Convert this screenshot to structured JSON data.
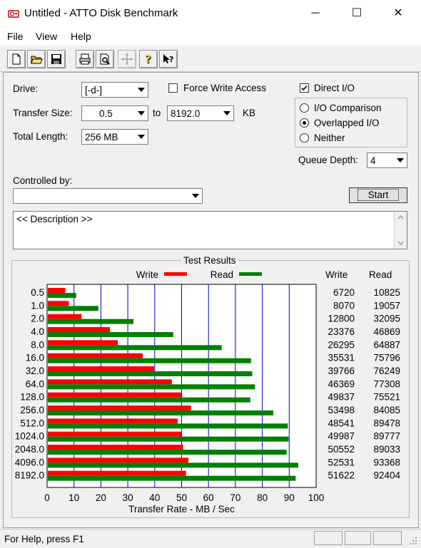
{
  "window": {
    "title": "Untitled - ATTO Disk Benchmark",
    "minimize": "─",
    "maximize": "☐",
    "close": "✕"
  },
  "menu": [
    "File",
    "View",
    "Help"
  ],
  "toolbar_icons": [
    "new-icon",
    "open-icon",
    "save-icon",
    "print-icon",
    "print-preview-icon",
    "move-icon",
    "help-icon",
    "context-help-icon"
  ],
  "form": {
    "drive_label": "Drive:",
    "drive_value": "[-d-]",
    "force_write_label": "Force Write Access",
    "force_write_checked": false,
    "direct_io_label": "Direct I/O",
    "direct_io_checked": true,
    "transfer_size_label": "Transfer Size:",
    "transfer_from": "0.5",
    "to_label": "to",
    "transfer_to": "8192.0",
    "kb_label": "KB",
    "total_length_label": "Total Length:",
    "total_length_value": "256 MB",
    "io_options": [
      "I/O Comparison",
      "Overlapped I/O",
      "Neither"
    ],
    "io_selected": "Overlapped I/O",
    "queue_depth_label": "Queue Depth:",
    "queue_depth_value": "4",
    "controlled_by_label": "Controlled by:",
    "controlled_by_value": "",
    "start_label": "Start",
    "description": "<< Description >>"
  },
  "results": {
    "group_title": "Test Results",
    "write_header": "Write",
    "read_header": "Read",
    "rows": [
      {
        "size": "0.5",
        "write": "6720",
        "read": "10825"
      },
      {
        "size": "1.0",
        "write": "8070",
        "read": "19057"
      },
      {
        "size": "2.0",
        "write": "12800",
        "read": "32095"
      },
      {
        "size": "4.0",
        "write": "23376",
        "read": "46869"
      },
      {
        "size": "8.0",
        "write": "26295",
        "read": "64887"
      },
      {
        "size": "16.0",
        "write": "35531",
        "read": "75796"
      },
      {
        "size": "32.0",
        "write": "39766",
        "read": "76249"
      },
      {
        "size": "64.0",
        "write": "46369",
        "read": "77308"
      },
      {
        "size": "128.0",
        "write": "49837",
        "read": "75521"
      },
      {
        "size": "256.0",
        "write": "53498",
        "read": "84085"
      },
      {
        "size": "512.0",
        "write": "48541",
        "read": "89478"
      },
      {
        "size": "1024.0",
        "write": "49987",
        "read": "89777"
      },
      {
        "size": "2048.0",
        "write": "50552",
        "read": "89033"
      },
      {
        "size": "4096.0",
        "write": "52531",
        "read": "93368"
      },
      {
        "size": "8192.0",
        "write": "51622",
        "read": "92404"
      }
    ]
  },
  "chart_data": {
    "type": "bar",
    "orientation": "horizontal",
    "categories": [
      "0.5",
      "1.0",
      "2.0",
      "4.0",
      "8.0",
      "16.0",
      "32.0",
      "64.0",
      "128.0",
      "256.0",
      "512.0",
      "1024.0",
      "2048.0",
      "4096.0",
      "8192.0"
    ],
    "series": [
      {
        "name": "Write",
        "color": "#ff0000",
        "values": [
          6.72,
          8.07,
          12.8,
          23.376,
          26.295,
          35.531,
          39.766,
          46.369,
          49.837,
          53.498,
          48.541,
          49.987,
          50.552,
          52.531,
          51.622
        ]
      },
      {
        "name": "Read",
        "color": "#008000",
        "values": [
          10.825,
          19.057,
          32.095,
          46.869,
          64.887,
          75.796,
          76.249,
          77.308,
          75.521,
          84.085,
          89.478,
          89.777,
          89.033,
          93.368,
          92.404
        ]
      }
    ],
    "xlabel": "Transfer Rate - MB / Sec",
    "xlim": [
      0,
      100
    ],
    "xticks": [
      0,
      10,
      20,
      30,
      40,
      50,
      60,
      70,
      80,
      90,
      100
    ],
    "grid": true,
    "grid_color": "#0000cc",
    "legend": "top"
  },
  "status": {
    "text": "For Help, press F1"
  }
}
